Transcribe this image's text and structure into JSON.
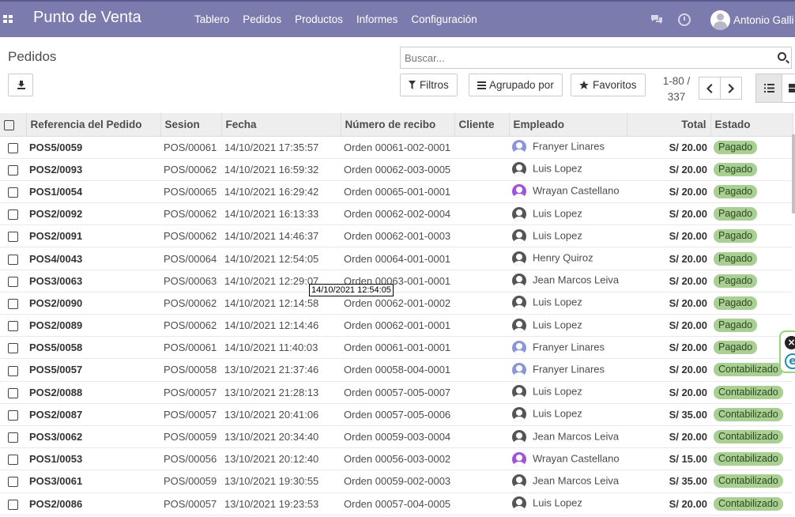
{
  "navbar": {
    "brand": "Punto de Venta",
    "menu": [
      "Tablero",
      "Pedidos",
      "Productos",
      "Informes",
      "Configuración"
    ],
    "user_name": "Antonio Galli"
  },
  "page": {
    "title": "Pedidos",
    "search_placeholder": "Buscar...",
    "filters_label": "Filtros",
    "group_by_label": "Agrupado por",
    "favorites_label": "Favoritos",
    "pager_range": "1-80 /",
    "pager_total": "337"
  },
  "table": {
    "columns": [
      "Referencia del Pedido",
      "Sesion",
      "Fecha",
      "Número de recibo",
      "Cliente",
      "Empleado",
      "Total",
      "Estado"
    ],
    "rows": [
      {
        "ref": "POS5/0059",
        "session": "POS/00061",
        "date": "14/10/2021 17:35:57",
        "receipt": "Orden 00061-002-0001",
        "client": "",
        "employee": "Franyer Linares",
        "avatar_color": "#8a96d8",
        "total": "S/ 20.00",
        "state": "Pagado"
      },
      {
        "ref": "POS2/0093",
        "session": "POS/00062",
        "date": "14/10/2021 16:59:32",
        "receipt": "Orden 00062-003-0005",
        "client": "",
        "employee": "Luis Lopez",
        "avatar_color": "#555555",
        "total": "S/ 20.00",
        "state": "Pagado"
      },
      {
        "ref": "POS1/0054",
        "session": "POS/00065",
        "date": "14/10/2021 16:29:42",
        "receipt": "Orden 00065-001-0001",
        "client": "",
        "employee": "Wrayan Castellano",
        "avatar_color": "#a054d8",
        "total": "S/ 20.00",
        "state": "Pagado"
      },
      {
        "ref": "POS2/0092",
        "session": "POS/00062",
        "date": "14/10/2021 16:13:33",
        "receipt": "Orden 00062-002-0004",
        "client": "",
        "employee": "Luis Lopez",
        "avatar_color": "#555555",
        "total": "S/ 20.00",
        "state": "Pagado"
      },
      {
        "ref": "POS2/0091",
        "session": "POS/00062",
        "date": "14/10/2021 14:46:37",
        "receipt": "Orden 00062-001-0003",
        "client": "",
        "employee": "Luis Lopez",
        "avatar_color": "#555555",
        "total": "S/ 20.00",
        "state": "Pagado"
      },
      {
        "ref": "POS4/0043",
        "session": "POS/00064",
        "date": "14/10/2021 12:54:05",
        "receipt": "Orden 00064-001-0001",
        "client": "",
        "employee": "Henry Quiroz",
        "avatar_color": "#555555",
        "total": "S/ 20.00",
        "state": "Pagado"
      },
      {
        "ref": "POS3/0063",
        "session": "POS/00063",
        "date": "14/10/2021 12:29:07",
        "receipt": "Orden 00063-001-0001",
        "client": "",
        "employee": "Jean Marcos Leiva",
        "avatar_color": "#555555",
        "total": "S/ 20.00",
        "state": "Pagado"
      },
      {
        "ref": "POS2/0090",
        "session": "POS/00062",
        "date": "14/10/2021 12:14:58",
        "receipt": "Orden 00062-001-0002",
        "client": "",
        "employee": "Luis Lopez",
        "avatar_color": "#555555",
        "total": "S/ 20.00",
        "state": "Pagado"
      },
      {
        "ref": "POS2/0089",
        "session": "POS/00062",
        "date": "14/10/2021 12:14:46",
        "receipt": "Orden 00062-001-0001",
        "client": "",
        "employee": "Luis Lopez",
        "avatar_color": "#555555",
        "total": "S/ 20.00",
        "state": "Pagado"
      },
      {
        "ref": "POS5/0058",
        "session": "POS/00061",
        "date": "14/10/2021 11:40:03",
        "receipt": "Orden 00061-001-0001",
        "client": "",
        "employee": "Franyer Linares",
        "avatar_color": "#8a96d8",
        "total": "S/ 20.00",
        "state": "Pagado"
      },
      {
        "ref": "POS5/0057",
        "session": "POS/00058",
        "date": "13/10/2021 21:37:46",
        "receipt": "Orden 00058-004-0001",
        "client": "",
        "employee": "Franyer Linares",
        "avatar_color": "#8a96d8",
        "total": "S/ 20.00",
        "state": "Contabilizado"
      },
      {
        "ref": "POS2/0088",
        "session": "POS/00057",
        "date": "13/10/2021 21:28:13",
        "receipt": "Orden 00057-005-0007",
        "client": "",
        "employee": "Luis Lopez",
        "avatar_color": "#555555",
        "total": "S/ 20.00",
        "state": "Contabilizado"
      },
      {
        "ref": "POS2/0087",
        "session": "POS/00057",
        "date": "13/10/2021 20:41:06",
        "receipt": "Orden 00057-005-0006",
        "client": "",
        "employee": "Luis Lopez",
        "avatar_color": "#555555",
        "total": "S/ 35.00",
        "state": "Contabilizado"
      },
      {
        "ref": "POS3/0062",
        "session": "POS/00059",
        "date": "13/10/2021 20:34:40",
        "receipt": "Orden 00059-003-0004",
        "client": "",
        "employee": "Jean Marcos Leiva",
        "avatar_color": "#555555",
        "total": "S/ 20.00",
        "state": "Contabilizado"
      },
      {
        "ref": "POS1/0053",
        "session": "POS/00056",
        "date": "13/10/2021 20:12:40",
        "receipt": "Orden 00056-003-0002",
        "client": "",
        "employee": "Wrayan Castellano",
        "avatar_color": "#a054d8",
        "total": "S/ 15.00",
        "state": "Contabilizado"
      },
      {
        "ref": "POS3/0061",
        "session": "POS/00059",
        "date": "13/10/2021 19:30:55",
        "receipt": "Orden 00059-002-0003",
        "client": "",
        "employee": "Jean Marcos Leiva",
        "avatar_color": "#555555",
        "total": "S/ 35.00",
        "state": "Contabilizado"
      },
      {
        "ref": "POS2/0086",
        "session": "POS/00057",
        "date": "13/10/2021 19:23:53",
        "receipt": "Orden 00057-004-0005",
        "client": "",
        "employee": "Luis Lopez",
        "avatar_color": "#555555",
        "total": "S/ 20.00",
        "state": "Contabilizado"
      }
    ]
  },
  "tooltip": "14/10/2021 12:54:05"
}
